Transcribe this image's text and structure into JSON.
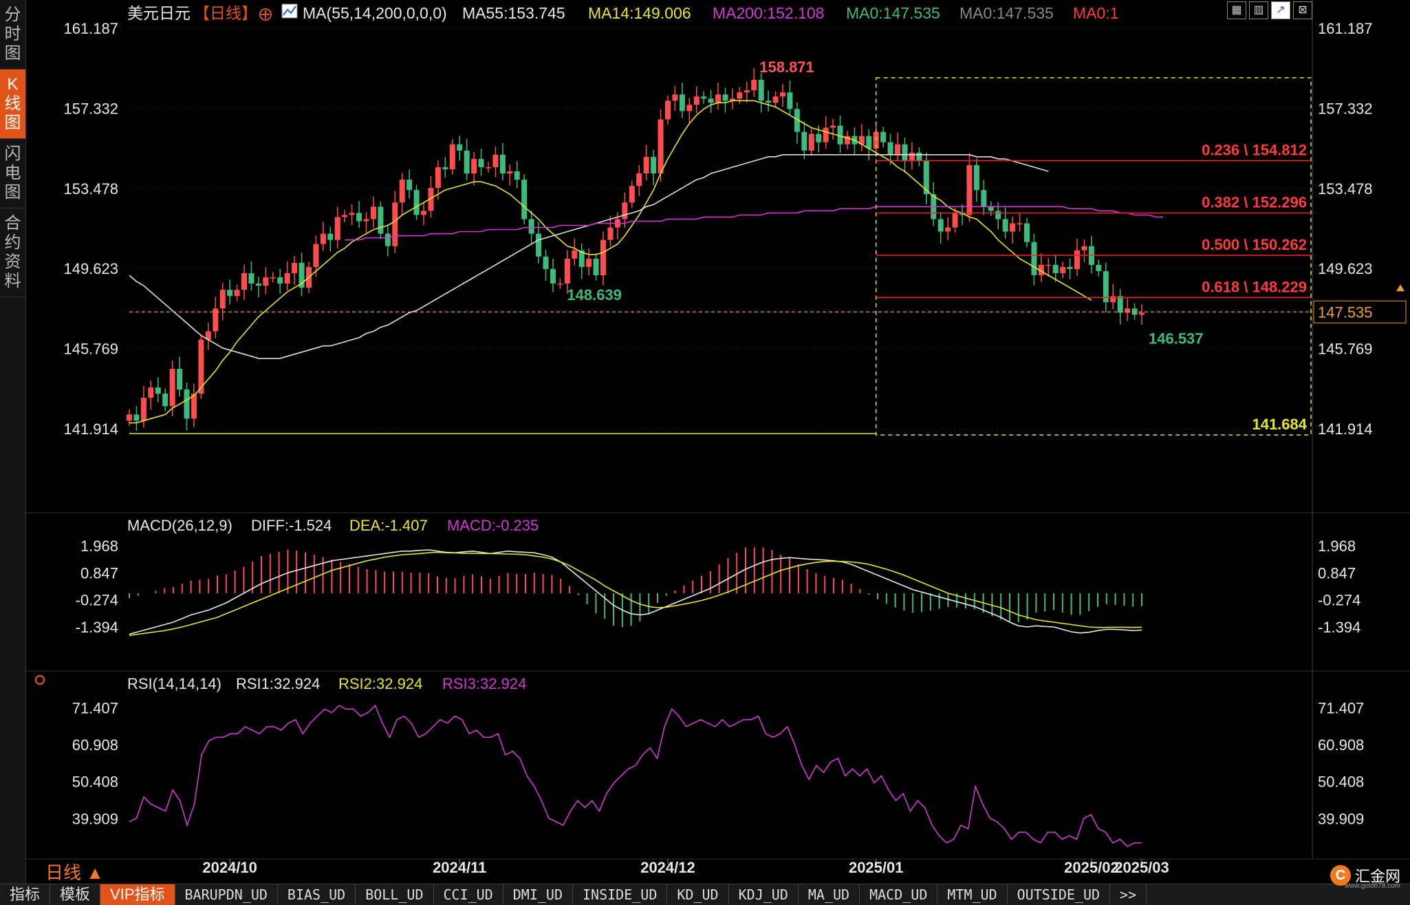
{
  "sidebar": {
    "items": [
      {
        "label": "分时图",
        "active": false
      },
      {
        "label": "K线图",
        "active": true
      },
      {
        "label": "闪电图",
        "active": false
      },
      {
        "label": "合约资料",
        "active": false
      }
    ]
  },
  "header": {
    "symbol": "美元日元",
    "period_tag": "【日线】",
    "add_icon": "plus-circle-icon",
    "ma_params": "MA(55,14,200,0,0,0)",
    "ma55": "MA55:153.745",
    "ma14": "MA14:149.006",
    "ma200": "MA200:152.108",
    "ma0a": "MA0:147.535",
    "ma0b": "MA0:147.535",
    "ma0c": "MA0:1"
  },
  "macd": {
    "title": "MACD(26,12,9)",
    "diff": "DIFF:-1.524",
    "dea": "DEA:-1.407",
    "macd": "MACD:-0.235"
  },
  "rsi": {
    "title": "RSI(14,14,14)",
    "rsi1": "RSI1:32.924",
    "rsi2": "RSI2:32.924",
    "rsi3": "RSI3:32.924"
  },
  "period_label": "日线 ▲",
  "bottom_tabs": [
    "指标",
    "模板",
    "VIP指标",
    "BARUPDN_UD",
    "BIAS_UD",
    "BOLL_UD",
    "CCI_UD",
    "DMI_UD",
    "INSIDE_UD",
    "KD_UD",
    "KDJ_UD",
    "MA_UD",
    "MACD_UD",
    "MTM_UD",
    "OUTSIDE_UD",
    ">>"
  ],
  "logo": {
    "text": "汇金网",
    "url": "www.gold678.com"
  },
  "colors": {
    "up": "#ff4d4d",
    "down": "#3dbb7d",
    "ma14": "#e6e62e",
    "ma55": "#e0e0e0",
    "ma200": "#d23ad2",
    "fib": "#ff2020",
    "accent": "#e0541a"
  },
  "chart_data": [
    {
      "type": "candlestick",
      "title": "美元日元【日线】",
      "y_ticks": [
        161.187,
        157.332,
        153.478,
        149.623,
        145.769,
        141.914
      ],
      "ylim": [
        141.914,
        161.187
      ],
      "x_ticks": [
        "2024/10",
        "2024/11",
        "2024/12",
        "2025/01",
        "2025/02",
        "2025/03"
      ],
      "last_price": 147.535,
      "annotations": {
        "high": 158.871,
        "local_low": 148.639,
        "last_low": 146.537,
        "range_low": 141.684
      },
      "fibonacci": [
        {
          "label": "0.236 \\ 154.812",
          "value": 154.812
        },
        {
          "label": "0.382 \\ 152.296",
          "value": 152.296
        },
        {
          "label": "0.500 \\ 150.262",
          "value": 150.262
        },
        {
          "label": "0.618 \\ 148.229",
          "value": 148.229
        }
      ],
      "closes": [
        142.6,
        142.3,
        143.4,
        143.9,
        143.6,
        143.0,
        144.8,
        143.8,
        142.4,
        143.6,
        146.2,
        146.6,
        147.7,
        148.6,
        148.3,
        148.6,
        149.4,
        148.9,
        148.8,
        149.2,
        149.2,
        148.9,
        149.4,
        149.9,
        148.7,
        149.7,
        150.8,
        151.3,
        151.0,
        152.1,
        152.2,
        152.3,
        151.9,
        152.0,
        152.6,
        151.3,
        150.7,
        152.8,
        153.9,
        153.4,
        152.2,
        152.4,
        153.5,
        154.5,
        154.4,
        155.6,
        155.3,
        154.2,
        154.9,
        154.5,
        154.5,
        155.1,
        154.2,
        154.3,
        153.9,
        152.0,
        151.3,
        150.2,
        149.6,
        148.9,
        148.9,
        150.1,
        150.5,
        149.7,
        150.1,
        149.3,
        151.0,
        151.6,
        152.0,
        152.8,
        153.6,
        154.2,
        155.0,
        154.2,
        156.8,
        157.7,
        158.0,
        157.2,
        157.5,
        157.9,
        157.8,
        157.6,
        158.0,
        157.7,
        157.8,
        158.1,
        158.2,
        158.7,
        157.7,
        157.6,
        157.9,
        158.1,
        157.3,
        156.2,
        155.3,
        156.1,
        155.7,
        156.4,
        156.5,
        155.6,
        156.0,
        155.6,
        156.0,
        155.4,
        156.2,
        155.7,
        155.1,
        155.6,
        154.8,
        155.2,
        154.8,
        153.2,
        152.0,
        151.4,
        151.6,
        152.3,
        152.2,
        154.6,
        153.4,
        152.6,
        152.4,
        152.0,
        151.4,
        151.8,
        151.8,
        150.9,
        149.3,
        149.8,
        149.8,
        149.4,
        149.7,
        149.6,
        150.5,
        150.7,
        149.8,
        149.5,
        148.0,
        148.3,
        147.5,
        147.7,
        147.4,
        147.5
      ],
      "ma14": [
        142.2,
        142.2,
        142.3,
        142.4,
        142.5,
        142.6,
        142.9,
        143.1,
        143.3,
        143.5,
        143.9,
        144.3,
        144.7,
        145.2,
        145.6,
        146.1,
        146.5,
        146.9,
        147.3,
        147.6,
        147.9,
        148.2,
        148.5,
        148.7,
        148.9,
        149.2,
        149.5,
        149.8,
        150.1,
        150.4,
        150.6,
        150.9,
        151.1,
        151.3,
        151.5,
        151.6,
        151.7,
        151.9,
        152.2,
        152.4,
        152.6,
        152.8,
        153.0,
        153.2,
        153.4,
        153.5,
        153.6,
        153.7,
        153.8,
        153.8,
        153.7,
        153.6,
        153.4,
        153.2,
        152.9,
        152.6,
        152.3,
        152.0,
        151.6,
        151.3,
        151.0,
        150.7,
        150.6,
        150.4,
        150.3,
        150.3,
        150.4,
        150.6,
        150.8,
        151.2,
        151.7,
        152.2,
        152.8,
        153.4,
        154.2,
        154.9,
        155.5,
        156.1,
        156.6,
        157.0,
        157.3,
        157.5,
        157.6,
        157.6,
        157.7,
        157.7,
        157.7,
        157.7,
        157.6,
        157.5,
        157.4,
        157.2,
        157.0,
        156.8,
        156.6,
        156.4,
        156.3,
        156.2,
        156.1,
        156.0,
        155.9,
        155.8,
        155.6,
        155.4,
        155.2,
        155.0,
        154.8,
        154.5,
        154.3,
        154.0,
        153.7,
        153.4,
        153.1,
        152.9,
        152.6,
        152.4,
        152.3,
        152.1,
        152.0,
        151.7,
        151.4,
        151.0,
        150.7,
        150.4,
        150.1,
        149.9,
        149.7,
        149.5,
        149.3,
        149.1,
        148.9,
        148.7,
        148.5,
        148.3,
        148.1
      ],
      "ma55": [
        149.3,
        149.0,
        148.8,
        148.5,
        148.2,
        147.9,
        147.6,
        147.3,
        147.0,
        146.7,
        146.4,
        146.2,
        146.0,
        145.8,
        145.7,
        145.6,
        145.5,
        145.4,
        145.3,
        145.3,
        145.3,
        145.3,
        145.4,
        145.5,
        145.6,
        145.7,
        145.8,
        145.9,
        145.9,
        146.0,
        146.1,
        146.2,
        146.3,
        146.5,
        146.6,
        146.8,
        146.9,
        147.1,
        147.3,
        147.5,
        147.6,
        147.8,
        148.0,
        148.2,
        148.4,
        148.6,
        148.8,
        149.0,
        149.2,
        149.4,
        149.6,
        149.8,
        150.0,
        150.2,
        150.4,
        150.6,
        150.8,
        151.0,
        151.1,
        151.2,
        151.3,
        151.4,
        151.5,
        151.6,
        151.7,
        151.8,
        151.9,
        152.0,
        152.1,
        152.2,
        152.3,
        152.4,
        152.6,
        152.7,
        152.9,
        153.1,
        153.3,
        153.5,
        153.7,
        153.9,
        154.0,
        154.2,
        154.3,
        154.4,
        154.5,
        154.6,
        154.7,
        154.8,
        154.9,
        155.0,
        155.0,
        155.1,
        155.1,
        155.1,
        155.1,
        155.1,
        155.1,
        155.1,
        155.1,
        155.1,
        155.1,
        155.1,
        155.1,
        155.1,
        155.1,
        155.1,
        155.1,
        155.1,
        155.1,
        155.1,
        155.1,
        155.1,
        155.1,
        155.1,
        155.1,
        155.1,
        155.1,
        155.1,
        155.0,
        155.0,
        155.0,
        154.9,
        154.9,
        154.8,
        154.7,
        154.6,
        154.5,
        154.4,
        154.3
      ],
      "ma200": [
        151.0,
        151.0,
        151.0,
        151.1,
        151.1,
        151.1,
        151.1,
        151.2,
        151.2,
        151.2,
        151.2,
        151.2,
        151.3,
        151.3,
        151.3,
        151.3,
        151.4,
        151.4,
        151.4,
        151.4,
        151.5,
        151.5,
        151.5,
        151.5,
        151.5,
        151.6,
        151.6,
        151.6,
        151.6,
        151.6,
        151.7,
        151.7,
        151.7,
        151.7,
        151.7,
        151.8,
        151.8,
        151.8,
        151.8,
        151.8,
        151.9,
        151.9,
        151.9,
        151.9,
        151.9,
        152.0,
        152.0,
        152.0,
        152.0,
        152.0,
        152.1,
        152.1,
        152.1,
        152.1,
        152.1,
        152.2,
        152.2,
        152.2,
        152.2,
        152.3,
        152.3,
        152.3,
        152.3,
        152.3,
        152.4,
        152.4,
        152.4,
        152.4,
        152.4,
        152.5,
        152.5,
        152.5,
        152.5,
        152.5,
        152.6,
        152.6,
        152.6,
        152.6,
        152.6,
        152.6,
        152.6,
        152.6,
        152.6,
        152.6,
        152.6,
        152.6,
        152.6,
        152.6,
        152.6,
        152.6,
        152.6,
        152.6,
        152.6,
        152.6,
        152.6,
        152.6,
        152.6,
        152.6,
        152.6,
        152.6,
        152.6,
        152.5,
        152.5,
        152.5,
        152.5,
        152.4,
        152.4,
        152.4,
        152.3,
        152.3,
        152.2,
        152.2,
        152.2,
        152.1,
        152.1
      ],
      "ma200_start_index": 30
    },
    {
      "type": "line",
      "title": "MACD(26,12,9)",
      "y_ticks": [
        1.968,
        0.847,
        -0.274,
        -1.394
      ],
      "series": [
        {
          "name": "DIFF",
          "values": [
            -1.7,
            -1.6,
            -1.5,
            -1.4,
            -1.3,
            -1.2,
            -1.05,
            -0.9,
            -0.8,
            -0.7,
            -0.55,
            -0.4,
            -0.2,
            0.0,
            0.2,
            0.4,
            0.55,
            0.7,
            0.85,
            0.95,
            1.05,
            1.15,
            1.25,
            1.35,
            1.4,
            1.45,
            1.5,
            1.55,
            1.6,
            1.65,
            1.7,
            1.75,
            1.75,
            1.78,
            1.8,
            1.75,
            1.7,
            1.68,
            1.72,
            1.75,
            1.7,
            1.65,
            1.7,
            1.75,
            1.72,
            1.7,
            1.68,
            1.6,
            1.5,
            1.3,
            1.0,
            0.7,
            0.4,
            0.1,
            -0.2,
            -0.5,
            -0.7,
            -0.85,
            -0.9,
            -0.85,
            -0.7,
            -0.55,
            -0.4,
            -0.25,
            -0.1,
            0.05,
            0.2,
            0.4,
            0.6,
            0.8,
            1.0,
            1.15,
            1.3,
            1.4,
            1.45,
            1.48,
            1.45,
            1.42,
            1.4,
            1.38,
            1.35,
            1.3,
            1.2,
            1.05,
            0.9,
            0.75,
            0.6,
            0.45,
            0.3,
            0.15,
            0.05,
            -0.05,
            -0.15,
            -0.25,
            -0.35,
            -0.45,
            -0.55,
            -0.7,
            -0.85,
            -1.0,
            -1.2,
            -1.35,
            -1.4,
            -1.35,
            -1.38,
            -1.4,
            -1.5,
            -1.6,
            -1.65,
            -1.62,
            -1.55,
            -1.5,
            -1.5,
            -1.52,
            -1.55,
            -1.53
          ]
        },
        {
          "name": "DEA",
          "values": [
            -1.75,
            -1.7,
            -1.65,
            -1.6,
            -1.55,
            -1.48,
            -1.4,
            -1.3,
            -1.2,
            -1.1,
            -1.0,
            -0.85,
            -0.7,
            -0.55,
            -0.4,
            -0.25,
            -0.1,
            0.05,
            0.2,
            0.35,
            0.5,
            0.65,
            0.8,
            0.95,
            1.05,
            1.15,
            1.25,
            1.35,
            1.42,
            1.5,
            1.55,
            1.6,
            1.62,
            1.65,
            1.68,
            1.7,
            1.68,
            1.67,
            1.66,
            1.66,
            1.65,
            1.65,
            1.64,
            1.63,
            1.62,
            1.6,
            1.55,
            1.5,
            1.42,
            1.3,
            1.15,
            0.95,
            0.75,
            0.55,
            0.3,
            0.1,
            -0.1,
            -0.3,
            -0.45,
            -0.55,
            -0.6,
            -0.58,
            -0.52,
            -0.45,
            -0.38,
            -0.3,
            -0.2,
            -0.08,
            0.05,
            0.2,
            0.35,
            0.5,
            0.65,
            0.8,
            0.95,
            1.05,
            1.15,
            1.22,
            1.28,
            1.32,
            1.33,
            1.32,
            1.3,
            1.26,
            1.2,
            1.1,
            1.0,
            0.88,
            0.75,
            0.6,
            0.45,
            0.3,
            0.15,
            0.0,
            -0.1,
            -0.2,
            -0.3,
            -0.4,
            -0.5,
            -0.6,
            -0.75,
            -0.9,
            -1.0,
            -1.1,
            -1.15,
            -1.2,
            -1.25,
            -1.3,
            -1.35,
            -1.4,
            -1.42,
            -1.42,
            -1.41,
            -1.41,
            -1.42,
            -1.41
          ]
        }
      ]
    },
    {
      "type": "line",
      "title": "RSI(14,14,14)",
      "y_ticks": [
        71.407,
        60.908,
        50.408,
        39.909
      ],
      "series": [
        {
          "name": "RSI1",
          "values": [
            39,
            40,
            46,
            44,
            43,
            42,
            48,
            45,
            38,
            44,
            58,
            62,
            63,
            63,
            64,
            64,
            66,
            65,
            64,
            66,
            66,
            65,
            67,
            68,
            64,
            67,
            69,
            71,
            70,
            72,
            71,
            71,
            69,
            70,
            72,
            67,
            63,
            68,
            69,
            67,
            63,
            64,
            66,
            68,
            67,
            69,
            68,
            64,
            65,
            63,
            63,
            64,
            58,
            59,
            57,
            52,
            49,
            45,
            40,
            39,
            38,
            42,
            45,
            43,
            45,
            42,
            47,
            50,
            52,
            54,
            55,
            58,
            60,
            57,
            66,
            71,
            69,
            66,
            67,
            68,
            67,
            66,
            68,
            66,
            67,
            68,
            68,
            69,
            64,
            63,
            64,
            66,
            61,
            55,
            51,
            55,
            53,
            56,
            57,
            52,
            54,
            52,
            54,
            50,
            52,
            48,
            45,
            47,
            42,
            45,
            43,
            38,
            35,
            33,
            34,
            38,
            37,
            49,
            44,
            40,
            39,
            37,
            34,
            36,
            36,
            34,
            33,
            36,
            36,
            34,
            35,
            34,
            40,
            41,
            37,
            36,
            33,
            34,
            32,
            33,
            33
          ]
        }
      ]
    }
  ]
}
